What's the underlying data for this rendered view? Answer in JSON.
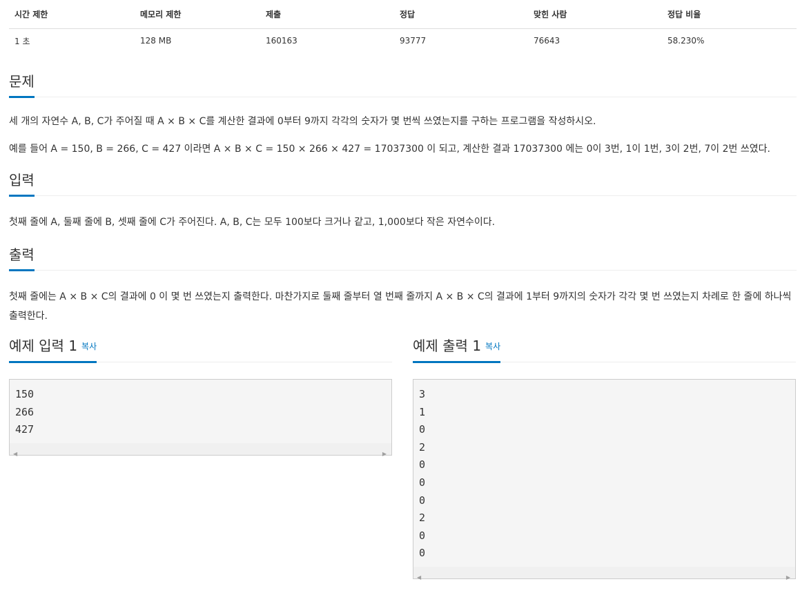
{
  "stats": {
    "headers": [
      "시간 제한",
      "메모리 제한",
      "제출",
      "정답",
      "맞힌 사람",
      "정답 비율"
    ],
    "values": [
      "1 초",
      "128 MB",
      "160163",
      "93777",
      "76643",
      "58.230%"
    ]
  },
  "problem": {
    "title": "문제",
    "paragraphs": [
      "세 개의 자연수 A, B, C가 주어질 때 A × B × C를 계산한 결과에 0부터 9까지 각각의 숫자가 몇 번씩 쓰였는지를 구하는 프로그램을 작성하시오.",
      "예를 들어 A = 150, B = 266, C = 427 이라면 A × B × C = 150 × 266 × 427 = 17037300 이 되고, 계산한 결과 17037300 에는 0이 3번, 1이 1번, 3이 2번, 7이 2번 쓰였다."
    ]
  },
  "input": {
    "title": "입력",
    "text": "첫째 줄에 A, 둘째 줄에 B, 셋째 줄에 C가 주어진다. A, B, C는 모두 100보다 크거나 같고, 1,000보다 작은 자연수이다."
  },
  "output": {
    "title": "출력",
    "text": "첫째 줄에는 A × B × C의 결과에 0 이 몇 번 쓰였는지 출력한다. 마찬가지로 둘째 줄부터 열 번째 줄까지 A × B × C의 결과에 1부터 9까지의 숫자가 각각 몇 번 쓰였는지 차례로 한 줄에 하나씩 출력한다."
  },
  "sample_input": {
    "title": "예제 입력 1",
    "copy_label": "복사",
    "content": "150\n266\n427"
  },
  "sample_output": {
    "title": "예제 출력 1",
    "copy_label": "복사",
    "content": "3\n1\n0\n2\n0\n0\n0\n2\n0\n0"
  },
  "colors": {
    "accent": "#0076c0",
    "sample_bg": "#f5f5f5"
  },
  "icons": {
    "scroll_left": "scroll-left-arrow-icon",
    "scroll_right": "scroll-right-arrow-icon"
  }
}
